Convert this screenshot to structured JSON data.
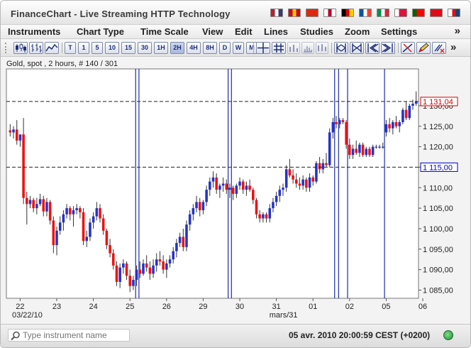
{
  "window": {
    "title": "FinanceChart - Live Streaming HTTP Technology",
    "languages": [
      {
        "name": "english",
        "colors": [
          "#b22234",
          "#ffffff",
          "#3c3b6e"
        ]
      },
      {
        "name": "spanish",
        "colors": [
          "#c60b1e",
          "#ffc400",
          "#c60b1e"
        ]
      },
      {
        "name": "chinese",
        "colors": [
          "#de2910",
          "#de2910",
          "#de2910"
        ]
      },
      {
        "name": "japanese",
        "colors": [
          "#ffffff",
          "#bc002d",
          "#ffffff"
        ]
      },
      {
        "name": "german",
        "colors": [
          "#000000",
          "#dd0000",
          "#ffce00"
        ]
      },
      {
        "name": "french",
        "colors": [
          "#0055a4",
          "#ffffff",
          "#ef4135"
        ]
      },
      {
        "name": "italian",
        "colors": [
          "#009246",
          "#ffffff",
          "#ce2b37"
        ]
      },
      {
        "name": "polish",
        "colors": [
          "#ffffff",
          "#dc143c",
          "#dc143c"
        ]
      },
      {
        "name": "portuguese",
        "colors": [
          "#006600",
          "#ff0000",
          "#ff0000"
        ]
      },
      {
        "name": "turkish",
        "colors": [
          "#e30a17",
          "#e30a17",
          "#e30a17"
        ]
      },
      {
        "name": "czech",
        "colors": [
          "#ffffff",
          "#d7141a",
          "#11457e"
        ]
      }
    ]
  },
  "menu": {
    "items": [
      "Instruments",
      "Chart Type",
      "Time Scale",
      "View",
      "Edit",
      "Lines",
      "Studies",
      "Zoom",
      "Settings"
    ],
    "more": "»"
  },
  "toolbar": {
    "timescales": [
      "T",
      "1",
      "5",
      "10",
      "15",
      "30",
      "1H",
      "2H",
      "4H",
      "8H",
      "D",
      "W",
      "M"
    ],
    "active_timescale": "2H",
    "more": "»"
  },
  "chart_header": {
    "label": "Gold, spot , 2 hours, # 140 / 301"
  },
  "chart_data": {
    "type": "candlestick",
    "instrument": "Gold, spot",
    "interval": "2 hours",
    "ylim": [
      1083,
      1139
    ],
    "yticks": [
      "1 130,00",
      "1 125,00",
      "1 120,00",
      "1 115,00",
      "1 110,00",
      "1 105,00",
      "1 100,00",
      "1 095,00",
      "1 090,00",
      "1 085,00"
    ],
    "ytick_values": [
      1130,
      1125,
      1120,
      1115,
      1110,
      1105,
      1100,
      1095,
      1090,
      1085
    ],
    "xticks": [
      "22",
      "23",
      "24",
      "25",
      "26",
      "29",
      "30",
      "31",
      "01",
      "02",
      "05",
      "06"
    ],
    "xtick_positions": [
      3,
      14,
      25,
      36,
      47,
      58,
      69,
      80,
      91,
      102,
      113,
      124
    ],
    "x_sublabels": [
      {
        "text": "03/22/10",
        "at": 3
      },
      {
        "text": "mars/31",
        "at": 80
      }
    ],
    "horizontal_levels": [
      {
        "value": 1131.04,
        "label": "1 131,04",
        "style": "dashed",
        "color": "#d40000"
      },
      {
        "value": 1115.0,
        "label": "1 115,00",
        "style": "dashed",
        "color": "#0000c0"
      }
    ],
    "vertical_markers": [
      37.7,
      38.7,
      65.5,
      66.5,
      97.5,
      98.7,
      101.4,
      112.5
    ],
    "up_color": "#2233cc",
    "down_color": "#ee1111",
    "candles": [
      {
        "o": 1124.0,
        "h": 1125.5,
        "l": 1122.5,
        "c": 1123.5
      },
      {
        "o": 1123.5,
        "h": 1125.0,
        "l": 1122.0,
        "c": 1124.2
      },
      {
        "o": 1124.2,
        "h": 1126.5,
        "l": 1120.5,
        "c": 1121.5
      },
      {
        "o": 1121.5,
        "h": 1123.0,
        "l": 1120.0,
        "c": 1123.0
      },
      {
        "o": 1123.0,
        "h": 1127.0,
        "l": 1106.0,
        "c": 1107.5
      },
      {
        "o": 1107.5,
        "h": 1109.0,
        "l": 1101.0,
        "c": 1106.0
      },
      {
        "o": 1106.0,
        "h": 1108.0,
        "l": 1105.0,
        "c": 1107.0
      },
      {
        "o": 1107.0,
        "h": 1107.5,
        "l": 1104.0,
        "c": 1105.0
      },
      {
        "o": 1105.0,
        "h": 1107.5,
        "l": 1103.5,
        "c": 1106.0
      },
      {
        "o": 1106.0,
        "h": 1108.5,
        "l": 1105.5,
        "c": 1107.2
      },
      {
        "o": 1107.2,
        "h": 1108.0,
        "l": 1103.0,
        "c": 1104.2
      },
      {
        "o": 1104.2,
        "h": 1107.5,
        "l": 1103.0,
        "c": 1106.5
      },
      {
        "o": 1106.5,
        "h": 1107.0,
        "l": 1101.0,
        "c": 1102.0
      },
      {
        "o": 1102.0,
        "h": 1103.0,
        "l": 1094.0,
        "c": 1096.0
      },
      {
        "o": 1096.0,
        "h": 1100.5,
        "l": 1093.5,
        "c": 1099.5
      },
      {
        "o": 1099.5,
        "h": 1103.0,
        "l": 1098.5,
        "c": 1101.5
      },
      {
        "o": 1101.5,
        "h": 1104.5,
        "l": 1099.5,
        "c": 1103.5
      },
      {
        "o": 1103.5,
        "h": 1106.0,
        "l": 1102.5,
        "c": 1105.0
      },
      {
        "o": 1105.0,
        "h": 1105.5,
        "l": 1102.0,
        "c": 1103.5
      },
      {
        "o": 1103.5,
        "h": 1105.5,
        "l": 1100.5,
        "c": 1104.5
      },
      {
        "o": 1104.5,
        "h": 1106.0,
        "l": 1103.5,
        "c": 1105.0
      },
      {
        "o": 1105.0,
        "h": 1105.5,
        "l": 1102.5,
        "c": 1104.0
      },
      {
        "o": 1104.0,
        "h": 1105.0,
        "l": 1096.0,
        "c": 1097.0
      },
      {
        "o": 1097.0,
        "h": 1099.5,
        "l": 1095.5,
        "c": 1098.0
      },
      {
        "o": 1098.0,
        "h": 1102.5,
        "l": 1097.0,
        "c": 1101.5
      },
      {
        "o": 1101.5,
        "h": 1104.0,
        "l": 1100.0,
        "c": 1103.0
      },
      {
        "o": 1103.0,
        "h": 1106.5,
        "l": 1102.0,
        "c": 1105.0
      },
      {
        "o": 1105.0,
        "h": 1106.0,
        "l": 1101.5,
        "c": 1102.5
      },
      {
        "o": 1102.5,
        "h": 1103.5,
        "l": 1098.5,
        "c": 1099.5
      },
      {
        "o": 1099.5,
        "h": 1100.0,
        "l": 1095.0,
        "c": 1096.0
      },
      {
        "o": 1096.0,
        "h": 1097.5,
        "l": 1093.0,
        "c": 1094.0
      },
      {
        "o": 1094.0,
        "h": 1095.0,
        "l": 1090.0,
        "c": 1091.0
      },
      {
        "o": 1091.0,
        "h": 1092.0,
        "l": 1086.0,
        "c": 1087.0
      },
      {
        "o": 1087.0,
        "h": 1091.5,
        "l": 1085.5,
        "c": 1090.5
      },
      {
        "o": 1090.5,
        "h": 1092.5,
        "l": 1089.0,
        "c": 1091.5
      },
      {
        "o": 1091.5,
        "h": 1092.0,
        "l": 1087.5,
        "c": 1088.5
      },
      {
        "o": 1088.5,
        "h": 1090.0,
        "l": 1084.5,
        "c": 1086.0
      },
      {
        "o": 1086.0,
        "h": 1088.5,
        "l": 1085.0,
        "c": 1087.5
      },
      {
        "o": 1087.5,
        "h": 1091.0,
        "l": 1086.0,
        "c": 1090.0
      },
      {
        "o": 1090.0,
        "h": 1092.0,
        "l": 1088.0,
        "c": 1089.0
      },
      {
        "o": 1089.0,
        "h": 1092.5,
        "l": 1088.5,
        "c": 1091.5
      },
      {
        "o": 1091.5,
        "h": 1093.5,
        "l": 1089.5,
        "c": 1090.5
      },
      {
        "o": 1090.5,
        "h": 1092.0,
        "l": 1087.5,
        "c": 1089.0
      },
      {
        "o": 1089.0,
        "h": 1092.5,
        "l": 1088.0,
        "c": 1091.0
      },
      {
        "o": 1091.0,
        "h": 1094.0,
        "l": 1089.5,
        "c": 1092.5
      },
      {
        "o": 1092.5,
        "h": 1094.5,
        "l": 1091.0,
        "c": 1092.0
      },
      {
        "o": 1092.0,
        "h": 1093.5,
        "l": 1089.0,
        "c": 1090.0
      },
      {
        "o": 1090.0,
        "h": 1092.5,
        "l": 1088.0,
        "c": 1091.5
      },
      {
        "o": 1091.5,
        "h": 1093.5,
        "l": 1090.5,
        "c": 1092.5
      },
      {
        "o": 1092.5,
        "h": 1095.5,
        "l": 1091.5,
        "c": 1094.5
      },
      {
        "o": 1094.5,
        "h": 1097.5,
        "l": 1093.0,
        "c": 1096.5
      },
      {
        "o": 1096.5,
        "h": 1099.0,
        "l": 1095.5,
        "c": 1098.0
      },
      {
        "o": 1098.0,
        "h": 1100.0,
        "l": 1094.5,
        "c": 1095.5
      },
      {
        "o": 1095.5,
        "h": 1102.0,
        "l": 1094.5,
        "c": 1101.0
      },
      {
        "o": 1101.0,
        "h": 1104.5,
        "l": 1099.5,
        "c": 1103.5
      },
      {
        "o": 1103.5,
        "h": 1106.0,
        "l": 1102.0,
        "c": 1105.0
      },
      {
        "o": 1105.0,
        "h": 1108.0,
        "l": 1104.0,
        "c": 1106.5
      },
      {
        "o": 1106.5,
        "h": 1107.5,
        "l": 1103.0,
        "c": 1104.5
      },
      {
        "o": 1104.5,
        "h": 1107.0,
        "l": 1103.5,
        "c": 1106.5
      },
      {
        "o": 1106.5,
        "h": 1110.5,
        "l": 1105.5,
        "c": 1109.5
      },
      {
        "o": 1109.5,
        "h": 1112.5,
        "l": 1108.0,
        "c": 1111.5
      },
      {
        "o": 1111.5,
        "h": 1114.0,
        "l": 1110.0,
        "c": 1112.5
      },
      {
        "o": 1112.5,
        "h": 1113.5,
        "l": 1108.5,
        "c": 1109.5
      },
      {
        "o": 1109.5,
        "h": 1111.0,
        "l": 1107.5,
        "c": 1110.5
      },
      {
        "o": 1110.5,
        "h": 1112.5,
        "l": 1109.0,
        "c": 1111.0
      },
      {
        "o": 1111.0,
        "h": 1112.0,
        "l": 1108.5,
        "c": 1109.5
      },
      {
        "o": 1109.5,
        "h": 1111.0,
        "l": 1107.5,
        "c": 1110.0
      },
      {
        "o": 1110.0,
        "h": 1110.5,
        "l": 1107.0,
        "c": 1108.5
      },
      {
        "o": 1108.5,
        "h": 1111.0,
        "l": 1107.5,
        "c": 1110.5
      },
      {
        "o": 1110.5,
        "h": 1112.5,
        "l": 1109.5,
        "c": 1111.5
      },
      {
        "o": 1111.5,
        "h": 1112.0,
        "l": 1108.5,
        "c": 1109.5
      },
      {
        "o": 1109.5,
        "h": 1111.5,
        "l": 1108.0,
        "c": 1110.5
      },
      {
        "o": 1110.5,
        "h": 1112.0,
        "l": 1109.0,
        "c": 1109.5
      },
      {
        "o": 1109.5,
        "h": 1110.0,
        "l": 1106.0,
        "c": 1107.0
      },
      {
        "o": 1107.0,
        "h": 1107.5,
        "l": 1102.5,
        "c": 1103.5
      },
      {
        "o": 1103.5,
        "h": 1104.5,
        "l": 1101.5,
        "c": 1102.5
      },
      {
        "o": 1102.5,
        "h": 1104.0,
        "l": 1101.5,
        "c": 1103.5
      },
      {
        "o": 1103.5,
        "h": 1104.0,
        "l": 1101.5,
        "c": 1102.5
      },
      {
        "o": 1102.5,
        "h": 1106.0,
        "l": 1101.5,
        "c": 1105.0
      },
      {
        "o": 1105.0,
        "h": 1107.5,
        "l": 1104.0,
        "c": 1106.5
      },
      {
        "o": 1106.5,
        "h": 1109.0,
        "l": 1105.5,
        "c": 1108.0
      },
      {
        "o": 1108.0,
        "h": 1110.5,
        "l": 1106.5,
        "c": 1109.5
      },
      {
        "o": 1109.5,
        "h": 1111.0,
        "l": 1108.0,
        "c": 1110.0
      },
      {
        "o": 1110.0,
        "h": 1115.5,
        "l": 1109.0,
        "c": 1114.5
      },
      {
        "o": 1114.5,
        "h": 1117.0,
        "l": 1112.5,
        "c": 1113.0
      },
      {
        "o": 1113.0,
        "h": 1114.5,
        "l": 1111.0,
        "c": 1112.0
      },
      {
        "o": 1112.0,
        "h": 1113.5,
        "l": 1110.0,
        "c": 1111.0
      },
      {
        "o": 1111.0,
        "h": 1112.5,
        "l": 1109.5,
        "c": 1110.5
      },
      {
        "o": 1110.5,
        "h": 1113.0,
        "l": 1109.5,
        "c": 1112.0
      },
      {
        "o": 1112.0,
        "h": 1112.5,
        "l": 1109.0,
        "c": 1110.0
      },
      {
        "o": 1110.0,
        "h": 1113.5,
        "l": 1109.0,
        "c": 1112.5
      },
      {
        "o": 1112.5,
        "h": 1113.0,
        "l": 1110.5,
        "c": 1111.5
      },
      {
        "o": 1111.5,
        "h": 1116.5,
        "l": 1111.0,
        "c": 1116.0
      },
      {
        "o": 1116.0,
        "h": 1117.5,
        "l": 1113.5,
        "c": 1114.5
      },
      {
        "o": 1114.5,
        "h": 1117.0,
        "l": 1113.5,
        "c": 1116.0
      },
      {
        "o": 1116.0,
        "h": 1118.5,
        "l": 1115.0,
        "c": 1115.5
      },
      {
        "o": 1115.5,
        "h": 1124.5,
        "l": 1115.0,
        "c": 1123.5
      },
      {
        "o": 1123.5,
        "h": 1127.0,
        "l": 1122.0,
        "c": 1126.0
      },
      {
        "o": 1126.0,
        "h": 1127.5,
        "l": 1124.5,
        "c": 1125.5
      },
      {
        "o": 1125.5,
        "h": 1127.0,
        "l": 1124.5,
        "c": 1126.5
      },
      {
        "o": 1126.5,
        "h": 1127.0,
        "l": 1125.5,
        "c": 1126.0
      },
      {
        "o": 1126.0,
        "h": 1126.5,
        "l": 1119.5,
        "c": 1120.5
      },
      {
        "o": 1120.5,
        "h": 1122.0,
        "l": 1117.0,
        "c": 1118.0
      },
      {
        "o": 1118.0,
        "h": 1120.5,
        "l": 1117.0,
        "c": 1119.5
      },
      {
        "o": 1119.5,
        "h": 1121.5,
        "l": 1118.0,
        "c": 1118.5
      },
      {
        "o": 1118.5,
        "h": 1121.0,
        "l": 1117.5,
        "c": 1120.5
      },
      {
        "o": 1120.5,
        "h": 1121.0,
        "l": 1117.5,
        "c": 1118.0
      },
      {
        "o": 1118.0,
        "h": 1120.0,
        "l": 1117.5,
        "c": 1119.5
      },
      {
        "o": 1119.5,
        "h": 1120.0,
        "l": 1117.5,
        "c": 1118.0
      },
      {
        "o": 1118.0,
        "h": 1120.5,
        "l": 1117.5,
        "c": 1120.0
      },
      {
        "o": 1120.0,
        "h": 1120.5,
        "l": 1119.5,
        "c": 1120.0
      },
      {
        "o": 1120.0,
        "h": 1120.5,
        "l": 1119.5,
        "c": 1120.0
      },
      {
        "o": 1120.0,
        "h": 1121.0,
        "l": 1119.5,
        "c": 1120.0
      },
      {
        "o": 1123.5,
        "h": 1126.5,
        "l": 1122.5,
        "c": 1125.5
      },
      {
        "o": 1125.5,
        "h": 1127.0,
        "l": 1123.5,
        "c": 1124.5
      },
      {
        "o": 1124.5,
        "h": 1126.5,
        "l": 1123.0,
        "c": 1126.0
      },
      {
        "o": 1126.0,
        "h": 1127.5,
        "l": 1124.5,
        "c": 1125.0
      },
      {
        "o": 1125.0,
        "h": 1126.5,
        "l": 1123.5,
        "c": 1126.0
      },
      {
        "o": 1126.0,
        "h": 1129.5,
        "l": 1125.5,
        "c": 1129.0
      },
      {
        "o": 1129.0,
        "h": 1131.0,
        "l": 1126.5,
        "c": 1127.0
      },
      {
        "o": 1127.0,
        "h": 1130.5,
        "l": 1126.5,
        "c": 1130.0
      },
      {
        "o": 1130.0,
        "h": 1131.5,
        "l": 1129.0,
        "c": 1130.5
      },
      {
        "o": 1130.5,
        "h": 1133.5,
        "l": 1130.0,
        "c": 1131.0
      }
    ]
  },
  "status": {
    "search_placeholder": "Type instrument name",
    "datetime": "05 avr. 2010 20:00:59  CEST (+0200)",
    "connection": "connected"
  }
}
